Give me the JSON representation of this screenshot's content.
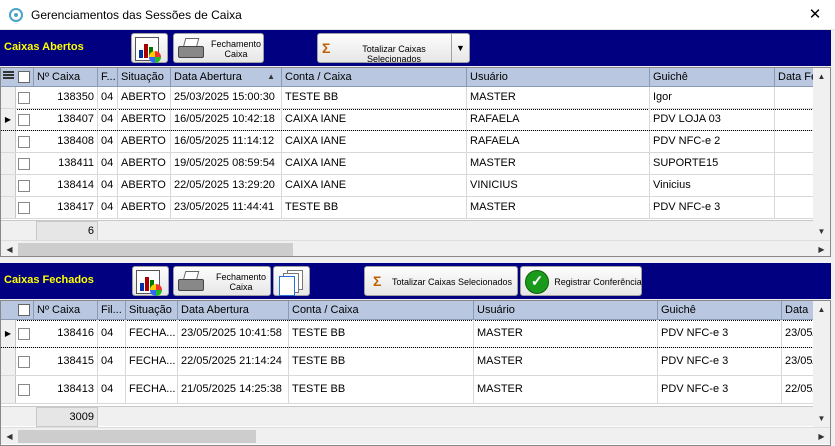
{
  "window": {
    "title": "Gerenciamentos das Sessões de Caixa",
    "close_glyph": "✕"
  },
  "open_section": {
    "title": "Caixas Abertos",
    "buttons": {
      "close_label_1": "Fechamento",
      "close_label_2": "Caixa",
      "totalize_label": "Totalizar Caixas Selecionados",
      "dropdown_glyph": "▼"
    },
    "columns": [
      "Nº Caixa",
      "F...",
      "Situação",
      "Data Abertura",
      "Conta / Caixa",
      "Usuário",
      "Guichê",
      "Data Fe"
    ],
    "sort_glyph": "▲",
    "rows": [
      {
        "num": "138350",
        "f": "04",
        "situacao": "ABERTO",
        "data": "25/03/2025 15:00:30",
        "conta": "TESTE BB",
        "usuario": "MASTER",
        "guiche": "Igor",
        "current": false
      },
      {
        "num": "138407",
        "f": "04",
        "situacao": "ABERTO",
        "data": "16/05/2025 10:42:18",
        "conta": "CAIXA IANE",
        "usuario": "RAFAELA",
        "guiche": "PDV LOJA 03",
        "current": true
      },
      {
        "num": "138408",
        "f": "04",
        "situacao": "ABERTO",
        "data": "16/05/2025 11:14:12",
        "conta": "CAIXA IANE",
        "usuario": "RAFAELA",
        "guiche": "PDV NFC-e 2",
        "current": false
      },
      {
        "num": "138411",
        "f": "04",
        "situacao": "ABERTO",
        "data": "19/05/2025 08:59:54",
        "conta": "CAIXA IANE",
        "usuario": "MASTER",
        "guiche": "SUPORTE15",
        "current": false
      },
      {
        "num": "138414",
        "f": "04",
        "situacao": "ABERTO",
        "data": "22/05/2025 13:29:20",
        "conta": "CAIXA IANE",
        "usuario": "VINICIUS",
        "guiche": "Vinicius",
        "current": false
      },
      {
        "num": "138417",
        "f": "04",
        "situacao": "ABERTO",
        "data": "23/05/2025 11:44:41",
        "conta": "TESTE BB",
        "usuario": "MASTER",
        "guiche": "PDV NFC-e 3",
        "current": false
      }
    ],
    "count": "6",
    "row_marker": "▶"
  },
  "closed_section": {
    "title": "Caixas Fechados",
    "buttons": {
      "close_label_1": "Fechamento",
      "close_label_2": "Caixa",
      "totalize_label": "Totalizar Caixas Selecionados",
      "register_label": "Registrar Conferência",
      "check_glyph": "✓"
    },
    "columns": [
      "Nº Caixa",
      "Fil...",
      "Situação",
      "Data Abertura",
      "Conta / Caixa",
      "Usuário",
      "Guichê",
      "Data"
    ],
    "rows": [
      {
        "num": "138416",
        "f": "04",
        "situacao": "FECHA...",
        "data": "23/05/2025 10:41:58",
        "conta": "TESTE BB",
        "usuario": "MASTER",
        "guiche": "PDV NFC-e 3",
        "datafe": "23/05/",
        "current": true
      },
      {
        "num": "138415",
        "f": "04",
        "situacao": "FECHA...",
        "data": "22/05/2025 21:14:24",
        "conta": "TESTE BB",
        "usuario": "MASTER",
        "guiche": "PDV NFC-e 3",
        "datafe": "23/05/",
        "current": false
      },
      {
        "num": "138413",
        "f": "04",
        "situacao": "FECHA...",
        "data": "21/05/2025 14:25:38",
        "conta": "TESTE BB",
        "usuario": "MASTER",
        "guiche": "PDV NFC-e 3",
        "datafe": "22/05/",
        "current": false
      }
    ],
    "count": "3009",
    "row_marker": "▶"
  },
  "scroll": {
    "left": "◀",
    "right": "▶",
    "up": "▲",
    "down": "▼"
  },
  "colors": {
    "section_bar": "#000080",
    "section_title": "#ffff00",
    "header": "#b9c8e0"
  }
}
